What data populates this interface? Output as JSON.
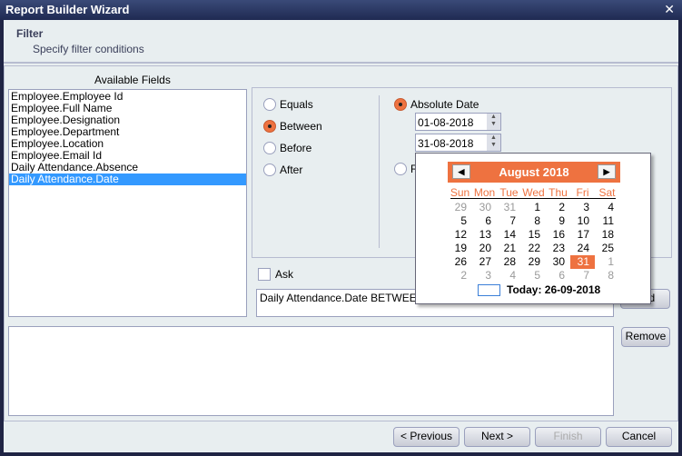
{
  "window": {
    "title": "Report Builder Wizard",
    "close": "✕"
  },
  "header": {
    "title": "Filter",
    "subtitle": "Specify filter conditions"
  },
  "fields": {
    "label": "Available Fields",
    "items": [
      "Employee.Employee Id",
      "Employee.Full Name",
      "Employee.Designation",
      "Employee.Department",
      "Employee.Location",
      "Employee.Email Id",
      "Daily Attendance.Absence",
      "Daily Attendance.Date"
    ],
    "selected_index": 7
  },
  "operators": [
    {
      "label": "Equals",
      "checked": false
    },
    {
      "label": "Between",
      "checked": true
    },
    {
      "label": "Before",
      "checked": false
    },
    {
      "label": "After",
      "checked": false
    }
  ],
  "date_mode": {
    "absolute": "Absolute Date",
    "relative": "R",
    "from": "01-08-2018",
    "to": "31-08-2018"
  },
  "ask_label": "Ask",
  "expression": "Daily Attendance.Date BETWEEN 0",
  "buttons": {
    "add": "Add",
    "remove": "Remove",
    "previous": "< Previous",
    "next": "Next >",
    "finish": "Finish",
    "cancel": "Cancel"
  },
  "calendar": {
    "month": "August 2018",
    "weekdays": [
      "Sun",
      "Mon",
      "Tue",
      "Wed",
      "Thu",
      "Fri",
      "Sat"
    ],
    "weeks": [
      [
        "29",
        "30",
        "31",
        "1",
        "2",
        "3",
        "4"
      ],
      [
        "5",
        "6",
        "7",
        "8",
        "9",
        "10",
        "11"
      ],
      [
        "12",
        "13",
        "14",
        "15",
        "16",
        "17",
        "18"
      ],
      [
        "19",
        "20",
        "21",
        "22",
        "23",
        "24",
        "25"
      ],
      [
        "26",
        "27",
        "28",
        "29",
        "30",
        "31",
        "1"
      ],
      [
        "2",
        "3",
        "4",
        "5",
        "6",
        "7",
        "8"
      ]
    ],
    "selected": "31",
    "today": "Today: 26-09-2018",
    "accent": "#ee7240"
  }
}
